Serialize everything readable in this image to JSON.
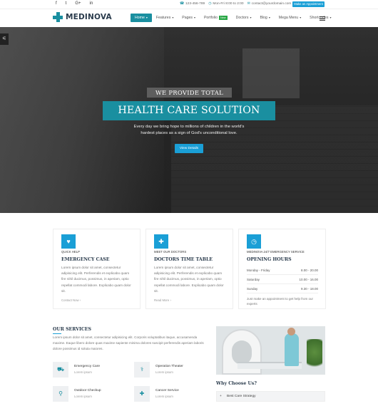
{
  "topbar": {
    "social": [
      "f",
      "t",
      "G+",
      "in"
    ],
    "phone": "123-456-789",
    "hours": "Mon-Fri 8:00 to 2:00",
    "email": "contact@yourdomain.com",
    "cta_label": "Make an Appointment"
  },
  "nav": {
    "logo": "MEDINOVA",
    "items": [
      {
        "label": "Home",
        "active": true
      },
      {
        "label": "Features"
      },
      {
        "label": "Pages"
      },
      {
        "label": "Portfolio",
        "badge": "New"
      },
      {
        "label": "Doctors"
      },
      {
        "label": "Blog"
      },
      {
        "label": "Mega Menu"
      },
      {
        "label": "Shortcodes"
      }
    ]
  },
  "hero": {
    "label1": "WE PROVIDE TOTAL",
    "label2": "HEALTH CARE SOLUTION",
    "subtitle": "Every day we bring hope to millions of children in the world's hardest places as a sign of God's unconditional love.",
    "button": "View Details"
  },
  "cards": [
    {
      "kicker": "QUICK HELP",
      "title": "EMERGENCY CASE",
      "text": "Lorem ipsum dolor sit amet, consectetur adipisicing elit. Perferendis et explicabo quam fire nihil ducimus, possimus, in aperiam, optio repellat commodi labore. Explicabo quam dolor sit.",
      "more": "Contact Now"
    },
    {
      "kicker": "MEET OUR DOCTORS",
      "title": "DOCTORS TIME TABLE",
      "text": "Lorem ipsum dolor sit amet, consectetur adipisicing elit. Perferendis et explicabo quam fire nihil ducimus, possimus, in aperiam, optio repellat commodi labore. Explicabo quam dolor sit.",
      "more": "Read More"
    },
    {
      "kicker": "MEDINOVA 24/7 EMERGENCY SERVICE",
      "title": "OPENING HOURS",
      "hours": [
        {
          "day": "Monday - Friday",
          "time": "8.00 - 20.00"
        },
        {
          "day": "Saturday",
          "time": "10.00 - 16.00"
        },
        {
          "day": "Sunday",
          "time": "9.30 - 18.00"
        }
      ],
      "note": "Just make an appointment to get help from our experts"
    }
  ],
  "services": {
    "title": "OUR SERVICES",
    "text": "Lorem ipsum dolor sit amet, consectetur adipisicing elit. Corporis voluptatibus itaque, accusamenda maxime. Eaque libero dolore quas maxime sapiente minima dolores suscipit perferendis aperiam laboris dolore possimus id soluta maiores.",
    "items": [
      {
        "name": "Emergency Care",
        "sub": "Lorem ipsum"
      },
      {
        "name": "Operation Theater",
        "sub": "Lorem ipsum"
      },
      {
        "name": "Outdoor Checkup",
        "sub": "Lorem ipsum"
      },
      {
        "name": "Cancer Service",
        "sub": "Lorem ipsum"
      }
    ]
  },
  "why": {
    "title": "Why Choose Us?",
    "first_item": "Best Care Strategy"
  }
}
